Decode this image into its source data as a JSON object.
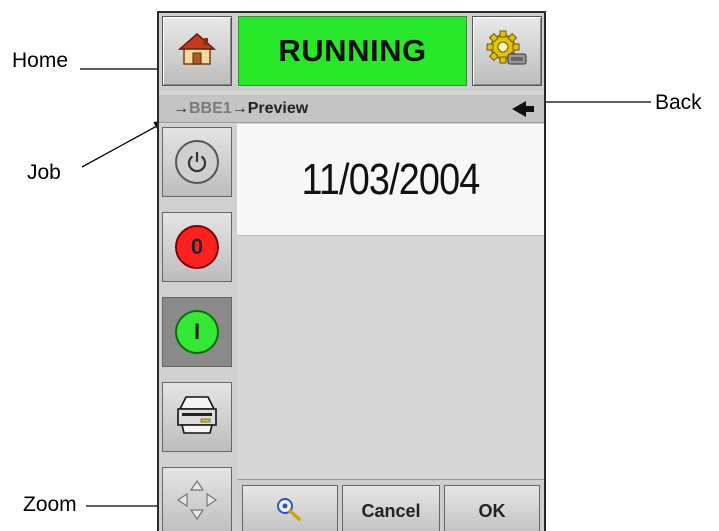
{
  "annotations": {
    "home": "Home",
    "back": "Back",
    "job": "Job",
    "zoom": "Zoom"
  },
  "header": {
    "status": "RUNNING",
    "status_color": "#29e829",
    "home_icon": "home-icon",
    "settings_icon": "settings-gear-icon"
  },
  "breadcrumb": {
    "job": "BBE1",
    "current": "Preview",
    "separator": "→"
  },
  "side_buttons": {
    "power": "power-icon",
    "stop_label": "0",
    "start_label": "I",
    "print_icon": "printer-icon",
    "nav_icon": "direction-pad-icon"
  },
  "preview": {
    "text": "11/03/2004"
  },
  "bottom": {
    "zoom_icon": "zoom-icon",
    "cancel_label": "Cancel",
    "ok_label": "OK"
  },
  "colors": {
    "stop": "#ff2020",
    "start": "#35e835"
  }
}
